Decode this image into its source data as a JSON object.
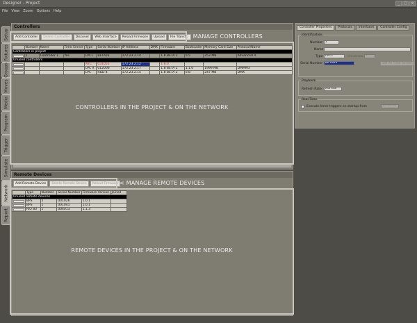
{
  "window": {
    "title": "Designer - Project"
  },
  "menu": [
    "File",
    "View",
    "Zoom",
    "Options",
    "Help"
  ],
  "vtabs": [
    "Setup",
    "Fixtures",
    "Groups",
    "Moves",
    "Media",
    "Program",
    "Trigger",
    "Simulate",
    "Network",
    "Report"
  ],
  "controllers": {
    "title": "Controllers",
    "toolbar": [
      "Add Controller",
      "Delete Controller",
      "Discover",
      "Web Interface",
      "Reload Firmware",
      "Upload",
      "File Transfer"
    ],
    "columns": [
      "",
      "Number",
      "Name",
      "Time Server",
      "Type",
      "Serial Number",
      "IP Address",
      "DMX",
      "Firmware",
      "Bootloader",
      "Memory Card Size",
      "Protocol/Name"
    ],
    "section_project": "Controllers in project",
    "section_unused": "Unused controllers",
    "project_rows": [
      [
        "",
        "1",
        "Controller 1",
        "Yes",
        "LPC1",
        "BETA03",
        "172.23.2.14",
        "",
        "1.8 BETA 2",
        "0.5",
        "253 MB",
        "Advanced A"
      ]
    ],
    "unused_rows": [
      [
        "",
        "",
        "",
        "",
        "AVC",
        "031051",
        "172.23.2.12",
        "",
        "1.8.0",
        "",
        "",
        ""
      ],
      [
        "",
        "",
        "",
        "",
        "LPC X",
        "012006",
        "172.23.2.17",
        "",
        "1.8 BETA 2",
        "1.1.0",
        "1999 MB",
        "DMMM3"
      ],
      [
        "",
        "",
        "",
        "",
        "LPC",
        "R&D 4",
        "172.23.2.15",
        "",
        "1.8 BETA 2",
        "0.8",
        "247 MB",
        "DMX"
      ]
    ]
  },
  "remote": {
    "title": "Remote Devices",
    "toolbar": [
      "Add Remote Device",
      "Delete Remote Device",
      "Reload Firmware"
    ],
    "columns": [
      "",
      "Type",
      "Number",
      "Serial Number",
      "Firmware Version",
      "Joined"
    ],
    "section_unused": "Unused remote devices",
    "rows": [
      [
        "",
        "BPS",
        "5",
        "001026",
        "1.0.1",
        ""
      ],
      [
        "",
        "BPS",
        "1",
        "001041",
        "1.0.1",
        ""
      ],
      [
        "",
        "RIO 80",
        "1",
        "004013",
        "1.1.3",
        ""
      ]
    ]
  },
  "annotations": {
    "manage_controllers": "< MANAGE CONTROLLERS",
    "controllers_body": "CONTROLLERS IN THE PROJECT & ON THE NETWORK",
    "manage_remote": "< MANAGE REMOTE DEVICES",
    "remote_body": "REMOTE DEVICES IN THE PROJECT & ON THE NETWORK"
  },
  "props": {
    "tabs": [
      "Controller Properties",
      "Protocols",
      "Interfaces",
      "Controller Config"
    ],
    "identification": {
      "label": "Identification",
      "number_label": "Number",
      "number_value": "1",
      "name_label": "Name",
      "name_value": "",
      "type_label": "Type",
      "type_value": "LPC1",
      "universes_label": "Universes",
      "universes_value": "1",
      "serial_label": "Serial Number",
      "serial_value": "BETA03",
      "time_server_button": "Set As Time Server"
    },
    "playback": {
      "label": "Playback",
      "refresh_label": "Refresh Rate",
      "refresh_value": "Normal"
    },
    "realtime": {
      "label": "Real Time",
      "execute_label": "Execute timer triggers on startup from",
      "time_value": "12:00:00"
    }
  },
  "colors": {
    "accent_selection": "#1e2f86",
    "firmware_red": "#cc3333"
  }
}
